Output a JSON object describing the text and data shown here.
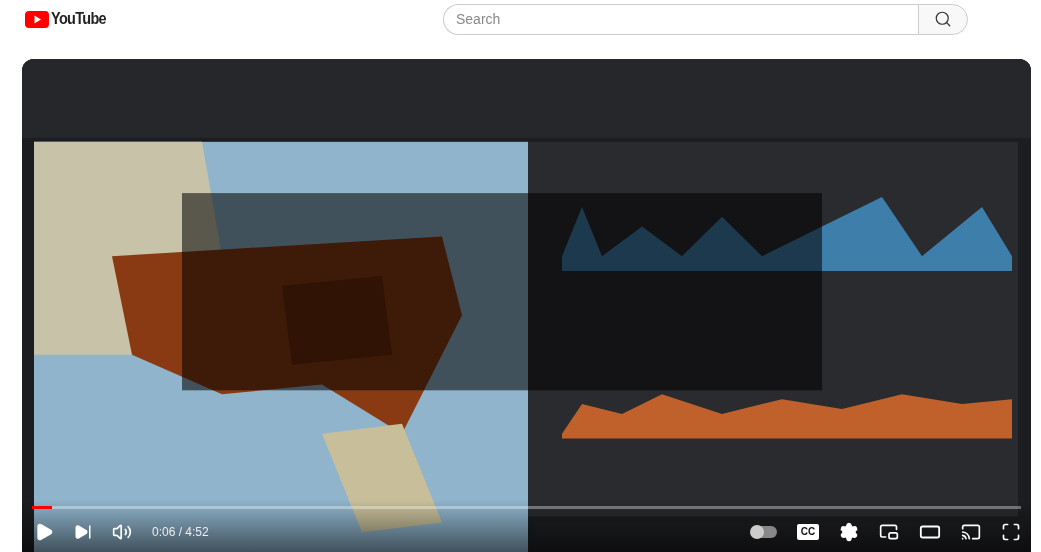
{
  "header": {
    "logo": "YouTube",
    "search": {
      "placeholder": "Search"
    }
  },
  "player": {
    "progress": {
      "level": 0.02
    },
    "time": "0:06 / 4:52",
    "autoplay": {
      "on": false
    },
    "captions": {
      "label": "CC",
      "on": false
    }
  }
}
